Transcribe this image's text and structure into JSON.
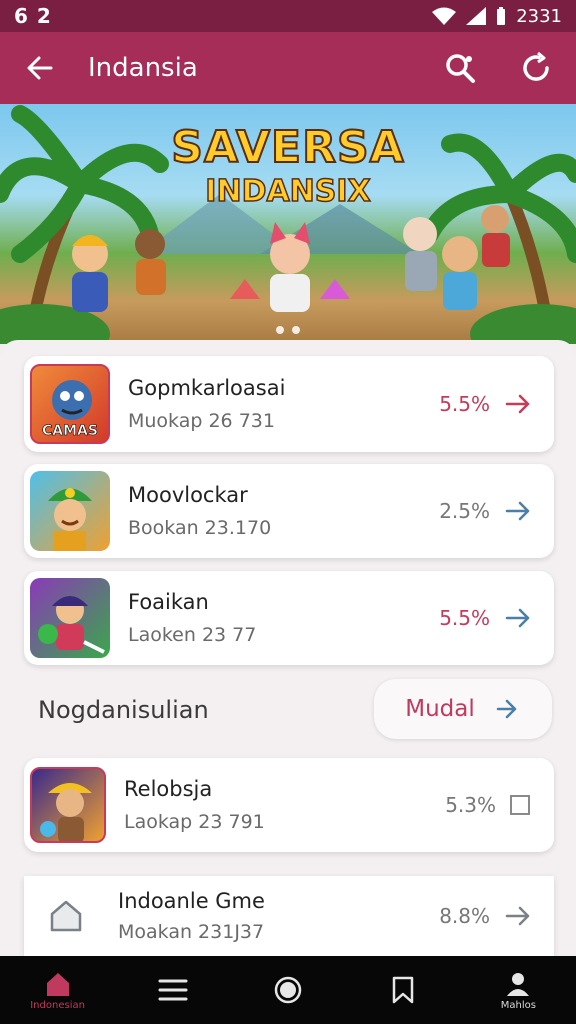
{
  "status_bar": {
    "time_left": "6 2",
    "time_right": "2331"
  },
  "app_bar": {
    "title": "Indansia",
    "colors": {
      "bar": "#a52d57",
      "status": "#7a1f42",
      "accent": "#c0395e"
    }
  },
  "banner": {
    "title_line1": "SAVERSA",
    "title_line2": "INDANSIX"
  },
  "cards": [
    {
      "name": "Gopmkarloasai",
      "sub": "Muokap 26 731",
      "percent": "5.5%",
      "thumb_caption": "CAMAS",
      "percent_accent": true
    },
    {
      "name": "Moovlockar",
      "sub": "Bookan 23.170",
      "percent": "2.5%",
      "thumb_caption": "",
      "percent_accent": false
    },
    {
      "name": "Foaikan",
      "sub": "Laoken 23 77",
      "percent": "5.5%",
      "thumb_caption": "",
      "percent_accent": true
    }
  ],
  "section": {
    "title": "Nogdanisulian",
    "action_label": "Mudal"
  },
  "card_extra": {
    "name": "Relobsja",
    "sub": "Laokap 23 791",
    "percent": "5.3%"
  },
  "card_last": {
    "name": "Indoanle Gme",
    "sub": "Moakan 231J37",
    "percent": "8.8%"
  },
  "bottom_nav": [
    {
      "label": "Indonesian",
      "icon": "home-icon",
      "active": true
    },
    {
      "label": "",
      "icon": "menu-icon",
      "active": false
    },
    {
      "label": "",
      "icon": "circle-icon",
      "active": false
    },
    {
      "label": "",
      "icon": "bookmark-icon",
      "active": false
    },
    {
      "label": "Mahlos",
      "icon": "profile-icon",
      "active": false
    }
  ]
}
